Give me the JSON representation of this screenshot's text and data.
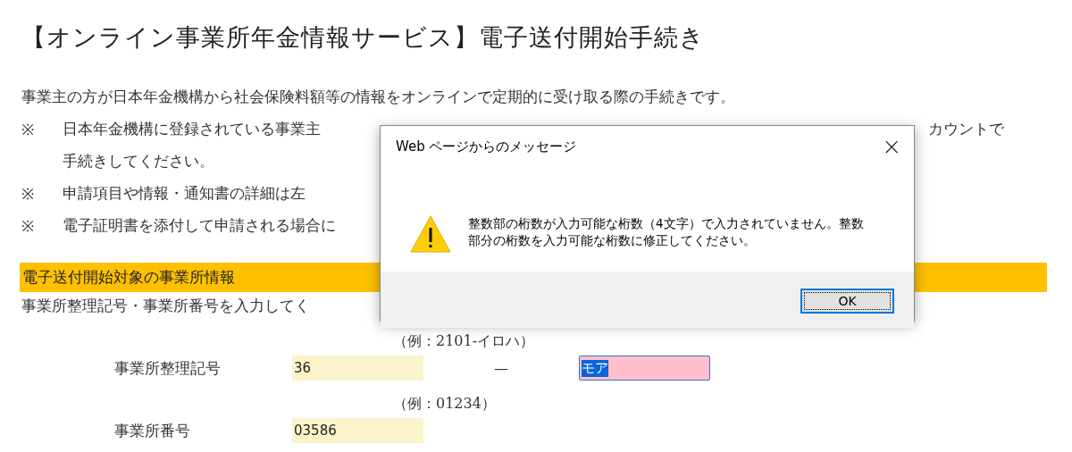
{
  "page_title": "【オンライン事業所年金情報サービス】電子送付開始手続き",
  "intro_lines": [
    {
      "parts": [
        "事業主の方が日本年金機構から社会保険料額等の情報をオンラインで定期的に受け取る際の手続きです。"
      ]
    },
    {
      "mark": "※",
      "parts": [
        "日本年金機構に登録されている事業主",
        "カウントで"
      ]
    },
    {
      "parts": [
        "手続きしてください。"
      ]
    },
    {
      "mark": "※",
      "parts": [
        "申請項目や情報・通知書の詳細は左"
      ]
    },
    {
      "mark": "※",
      "parts": [
        "電子証明書を添付して申請される場合に"
      ]
    }
  ],
  "section": {
    "title": "電子送付開始対象の事業所情報",
    "instruction": "事業所整理記号・事業所番号を入力してく",
    "fields": [
      {
        "example": "（例：2101-イロハ）",
        "label": "事業所整理記号",
        "inputs": [
          {
            "value": "36",
            "error": false,
            "text_selected": false
          },
          {
            "value": "モア",
            "error": true,
            "text_selected": true
          }
        ],
        "separator": "—"
      },
      {
        "example": "（例：01234）",
        "label": "事業所番号",
        "inputs": [
          {
            "value": "03586",
            "error": false,
            "text_selected": false
          }
        ]
      }
    ]
  },
  "dialog": {
    "title": "Web ページからのメッセージ",
    "close": "×",
    "message": "整数部の桁数が入力可能な桁数（4文字）で入力されていません。整数部分の桁数を入力可能な桁数に修正してください。",
    "buttons": [
      {
        "label": "OK",
        "focused": true
      }
    ]
  }
}
